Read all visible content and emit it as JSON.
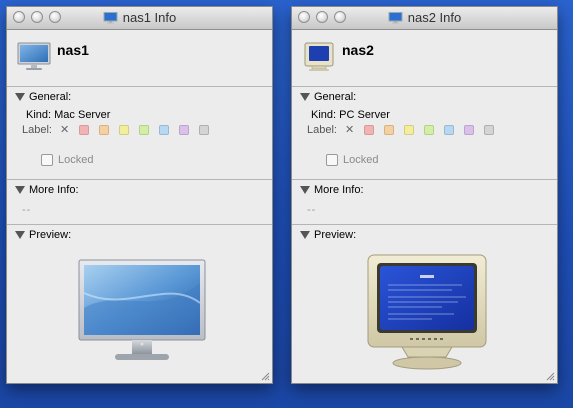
{
  "windows": [
    {
      "title": "nas1 Info",
      "name": "nas1",
      "general_label": "General:",
      "kind_label": "Kind:",
      "kind_value": "Mac Server",
      "label_label": "Label:",
      "label_clear": "✕",
      "locked": "Locked",
      "more_info_label": "More Info:",
      "more_info_value": "--",
      "preview_label": "Preview:",
      "icon": "lcd-display-icon"
    },
    {
      "title": "nas2 Info",
      "name": "nas2",
      "general_label": "General:",
      "kind_label": "Kind:",
      "kind_value": "PC Server",
      "label_label": "Label:",
      "label_clear": "✕",
      "locked": "Locked",
      "more_info_label": "More Info:",
      "more_info_value": "--",
      "preview_label": "Preview:",
      "icon": "crt-monitor-icon"
    }
  ],
  "label_colors": [
    "#f2b3b3",
    "#f5d0a2",
    "#f2ee9c",
    "#d2efa5",
    "#b8d8f2",
    "#dcc0ec",
    "#d4d4d4"
  ],
  "desktop_color": "#2a63cf"
}
